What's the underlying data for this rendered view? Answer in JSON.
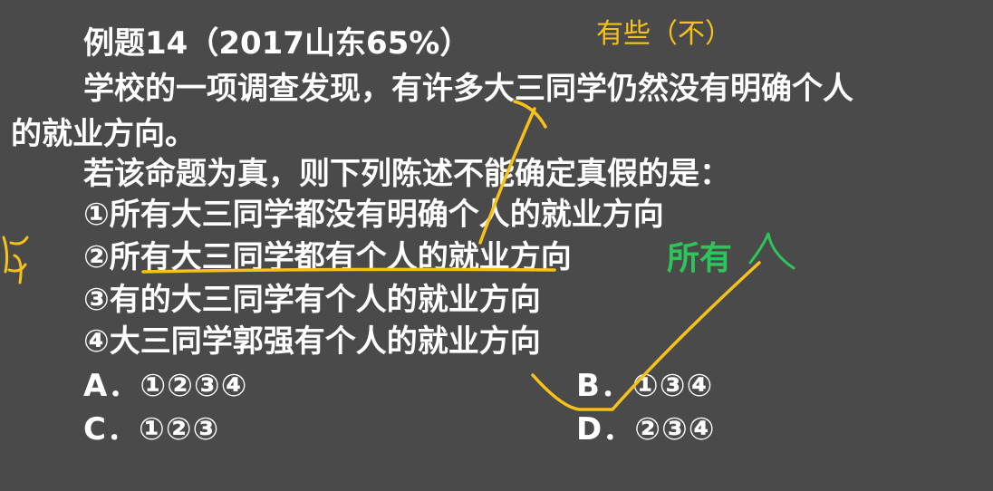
{
  "question": {
    "title": "例题14（2017山东65%）",
    "stem_line1": "学校的一项调查发现，有许多大三同学仍然没有明确个人",
    "stem_line2": "的就业方向。",
    "prompt": "若该命题为真，则下列陈述不能确定真假的是：",
    "statements": [
      "①所有大三同学都没有明确个人的就业方向",
      "②所有大三同学都有个人的就业方向",
      "③有的大三同学有个人的就业方向",
      "④大三同学郭强有个人的就业方向"
    ],
    "choices": {
      "A": "A．①②③④",
      "B": "B．①③④",
      "C": "C．①②③",
      "D": "D．②③④"
    }
  },
  "annotations": {
    "top_note": "有些（不）",
    "side_note": "所有",
    "colors": {
      "yellow": "#f6c21a",
      "green": "#2fc45a",
      "background": "#4a4a4a",
      "text": "#ffffff"
    }
  }
}
